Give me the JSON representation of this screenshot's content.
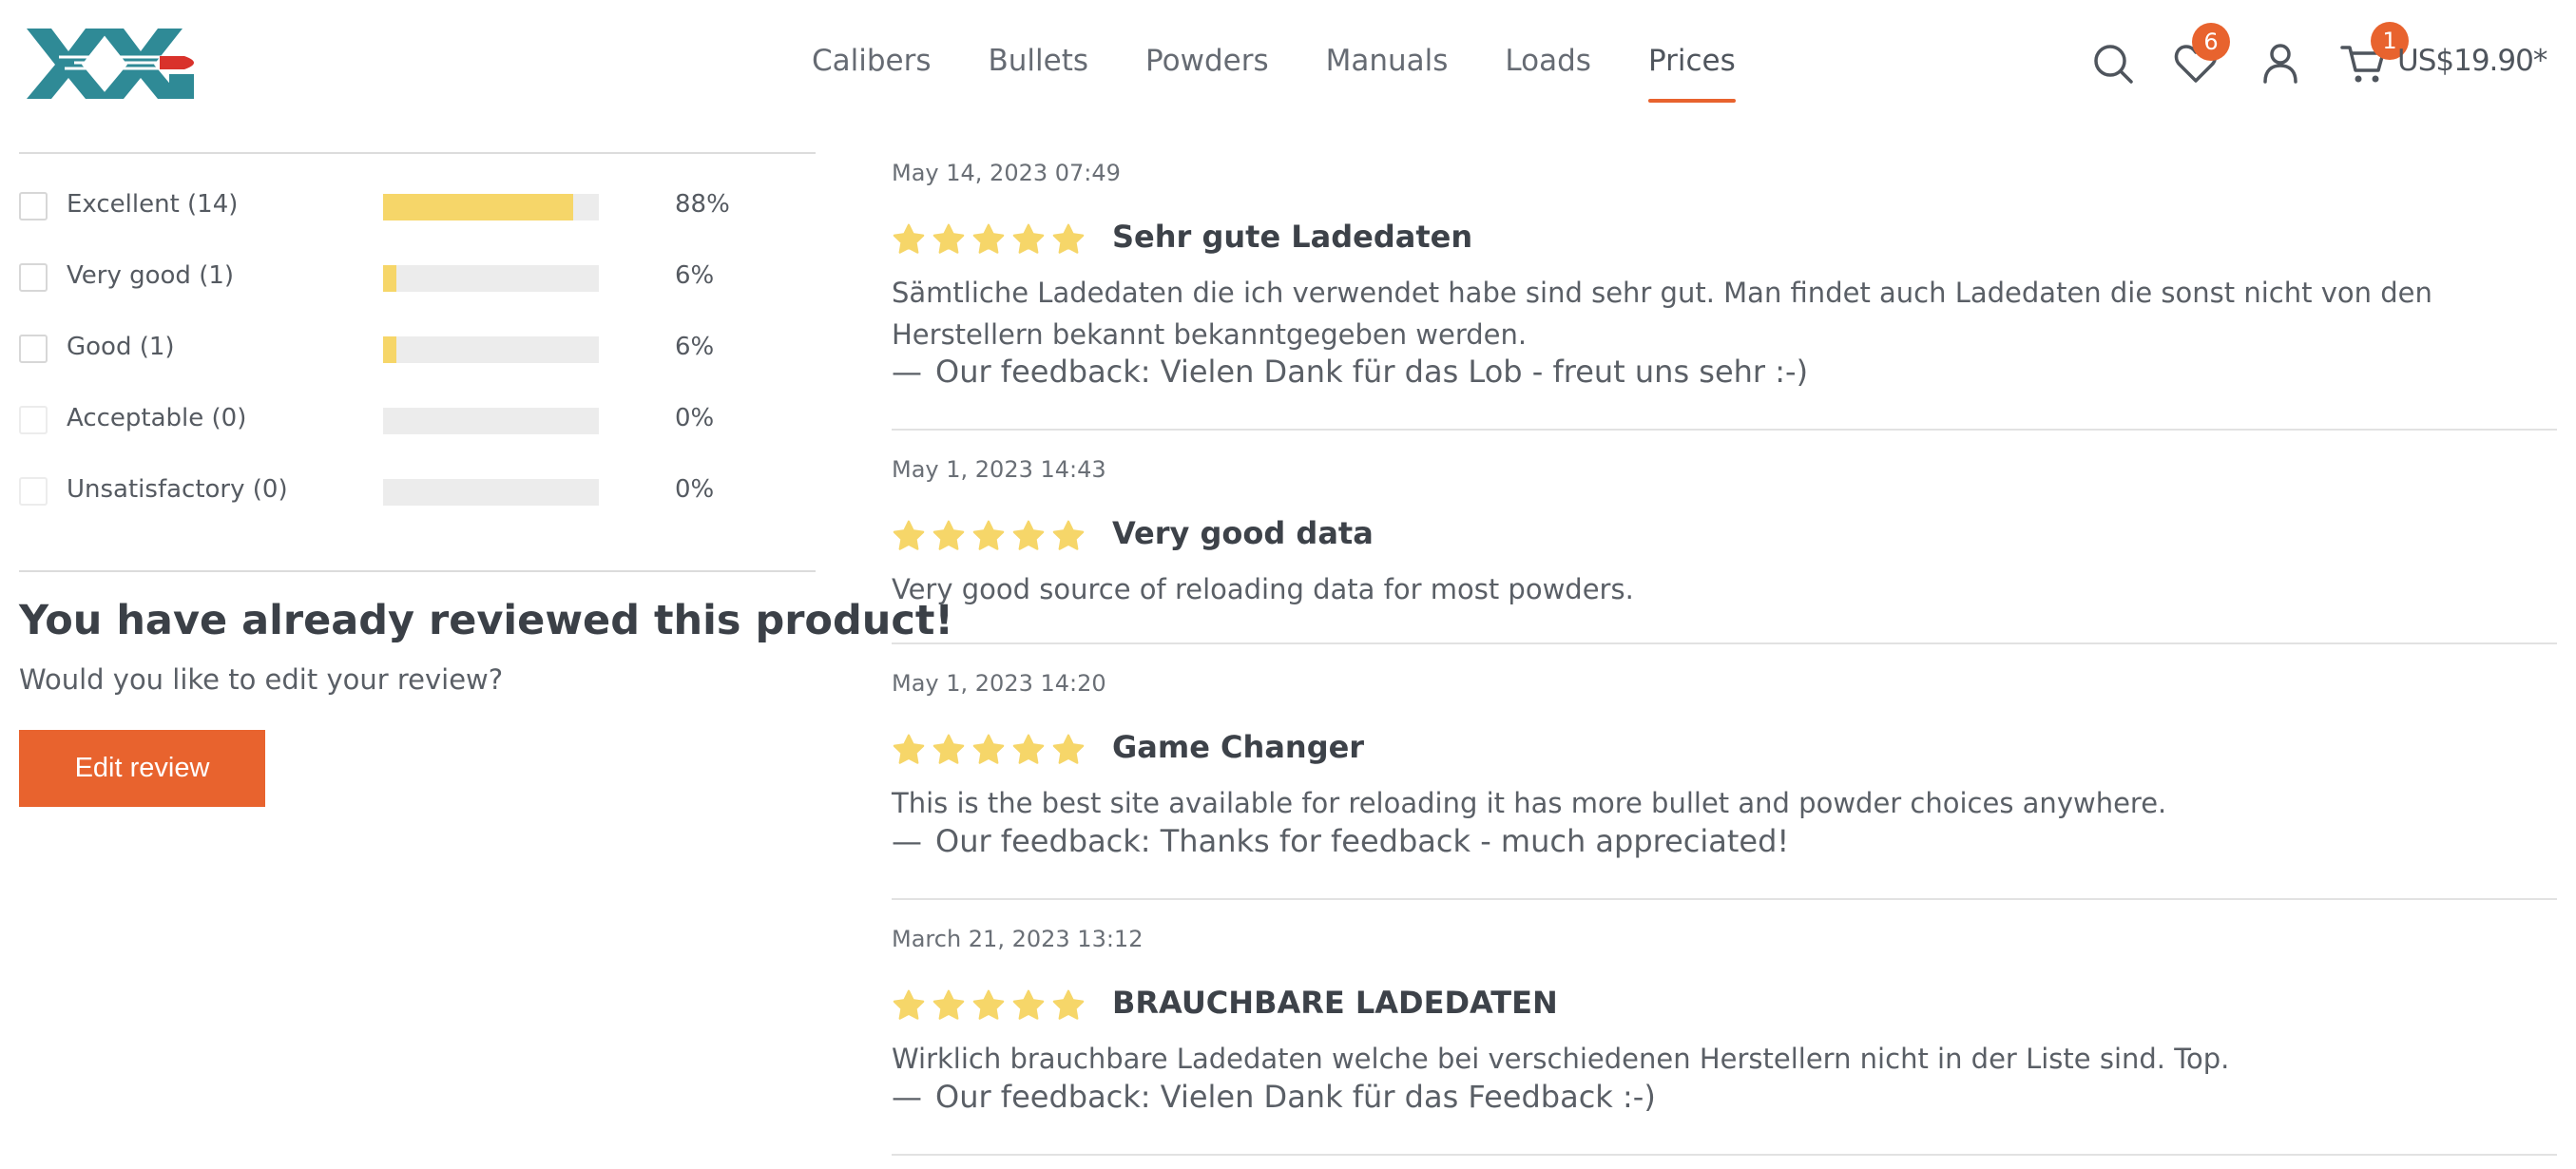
{
  "header": {
    "nav": [
      "Calibers",
      "Bullets",
      "Powders",
      "Manuals",
      "Loads",
      "Prices"
    ],
    "active_nav": "Prices",
    "wishlist_count": "6",
    "cart_count": "1",
    "cart_total": "US$19.90*",
    "accent_color": "#e8632e",
    "logo_color": "#2f8a96"
  },
  "rating_filter": [
    {
      "label": "Excellent (14)",
      "percent_text": "88%",
      "share": 0.88
    },
    {
      "label": "Very good (1)",
      "percent_text": "6%",
      "share": 0.06
    },
    {
      "label": "Good (1)",
      "percent_text": "6%",
      "share": 0.06
    },
    {
      "label": "Acceptable (0)",
      "percent_text": "0%",
      "share": 0.0
    },
    {
      "label": "Unsatisfactory (0)",
      "percent_text": "0%",
      "share": 0.0
    }
  ],
  "already_reviewed": {
    "title": "You have already reviewed this product!",
    "subtitle": "Would you like to edit your review?",
    "button": "Edit review"
  },
  "reviews": [
    {
      "date": "May 14, 2023 07:49",
      "rating": 5,
      "title": "Sehr gute Ladedaten",
      "body": "Sämtliche Ladedaten die ich verwendet habe sind sehr gut. Man findet auch Ladedaten die sonst nicht von den Herstellern bekannt bekanntgegeben werden.",
      "feedback": "Our feedback: Vielen Dank für das Lob - freut uns sehr :-)"
    },
    {
      "date": "May 1, 2023 14:43",
      "rating": 5,
      "title": "Very good data",
      "body": "Very good source of reloading data for most powders.",
      "feedback": null
    },
    {
      "date": "May 1, 2023 14:20",
      "rating": 5,
      "title": "Game Changer",
      "body": "This is the best site available for reloading it has more bullet and powder choices anywhere.",
      "feedback": "Our feedback: Thanks for feedback - much appreciated!"
    },
    {
      "date": "March 21, 2023 13:12",
      "rating": 5,
      "title": "BRAUCHBARE LADEDATEN",
      "body": "Wirklich brauchbare Ladedaten welche bei verschiedenen Herstellern nicht in der Liste sind. Top.",
      "feedback": "Our feedback: Vielen Dank für das Feedback :-)"
    }
  ],
  "feedback_dash": "—",
  "star_color": "#f6d669"
}
